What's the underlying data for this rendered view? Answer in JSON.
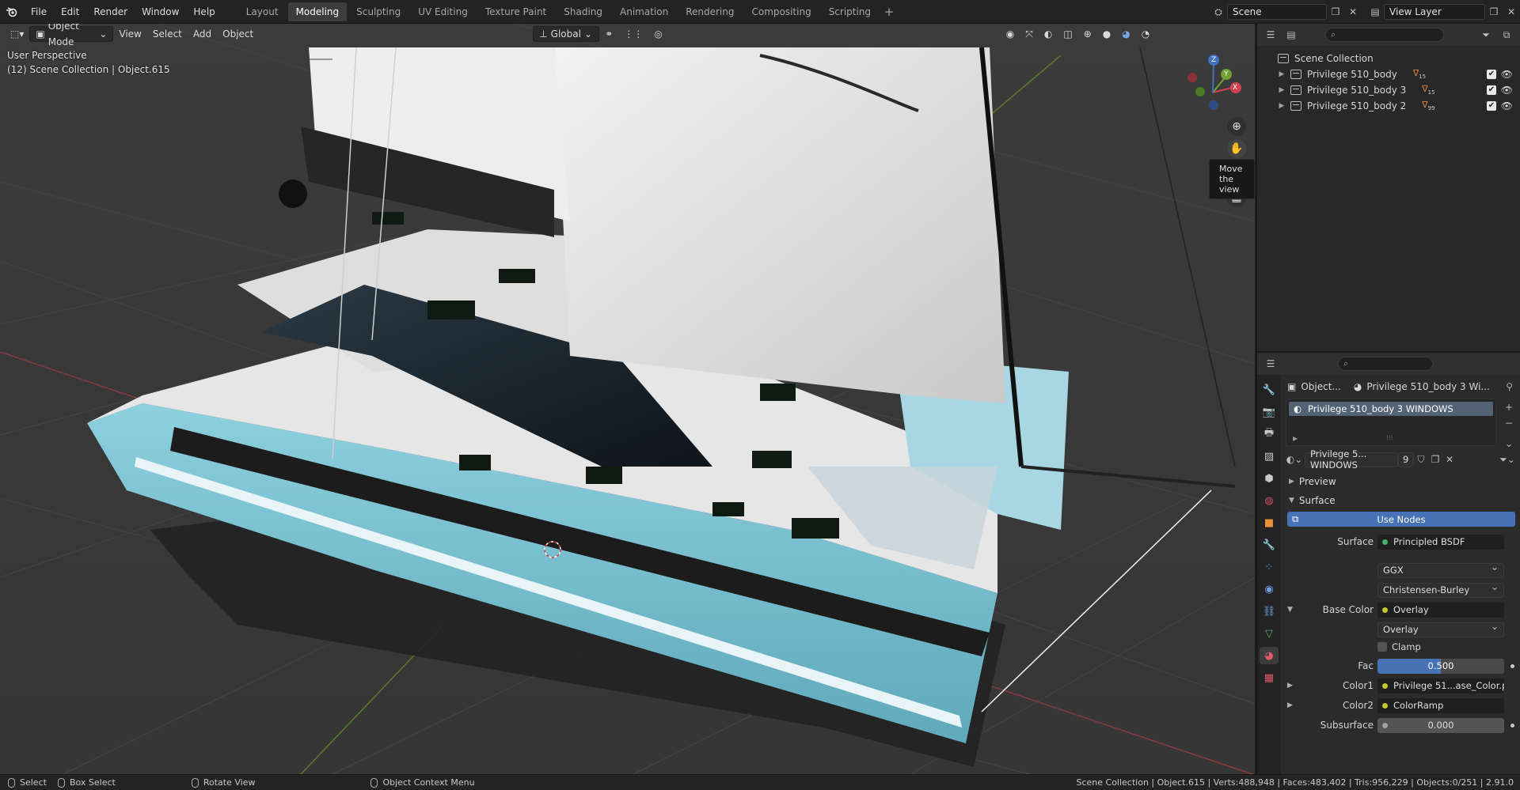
{
  "menubar": {
    "items": [
      "File",
      "Edit",
      "Render",
      "Window",
      "Help"
    ],
    "workspaces": [
      "Layout",
      "Modeling",
      "Sculpting",
      "UV Editing",
      "Texture Paint",
      "Shading",
      "Animation",
      "Rendering",
      "Compositing",
      "Scripting"
    ],
    "active_workspace": "Modeling",
    "add_tab": "+",
    "scene_name": "Scene",
    "view_layer": "View Layer"
  },
  "viewport": {
    "mode": "Object Mode",
    "menus": [
      "View",
      "Select",
      "Add",
      "Object"
    ],
    "transform_orientation": "Global",
    "perspective_label": "User Perspective",
    "collection_label": "(12) Scene Collection | Object.615",
    "gizmo_axes": [
      "X",
      "Y",
      "Z"
    ],
    "tooltip": "Move the view",
    "hull_accent": "#7cc3d4"
  },
  "outliner": {
    "root": "Scene Collection",
    "items": [
      {
        "label": "Privilege 510_body",
        "badge": "15"
      },
      {
        "label": "Privilege 510_body 3",
        "badge": "15"
      },
      {
        "label": "Privilege 510_body 2",
        "badge": "99"
      }
    ]
  },
  "properties": {
    "breadcrumb_object": "Object...",
    "breadcrumb_material": "Privilege 510_body 3 Wi...",
    "slot_name": "Privilege 510_body 3 WINDOWS",
    "material_name": "Privilege 5... WINDOWS",
    "user_count": "9",
    "sections": {
      "preview": "Preview",
      "surface": "Surface"
    },
    "use_nodes": "Use Nodes",
    "surface_label": "Surface",
    "surface_value": "Principled BSDF",
    "distribution": "GGX",
    "subsurface_method": "Christensen-Burley",
    "base_color_label": "Base Color",
    "base_color_value": "Overlay",
    "blend_mode": "Overlay",
    "clamp_label": "Clamp",
    "fac_label": "Fac",
    "fac_value": "0.500",
    "fac_fraction": 0.5,
    "color1_label": "Color1",
    "color1_value": "Privilege 51...ase_Color.png",
    "color2_label": "Color2",
    "color2_value": "ColorRamp",
    "subsurface_label": "Subsurface",
    "subsurface_value": "0.000",
    "accent": "#4772b3"
  },
  "statusbar": {
    "select": "Select",
    "box_select": "Box Select",
    "rotate_view": "Rotate View",
    "context_menu": "Object Context Menu",
    "stats": "Scene Collection | Object.615 | Verts:488,948 | Faces:483,402 | Tris:956,229 | Objects:0/251 | 2.91.0"
  }
}
